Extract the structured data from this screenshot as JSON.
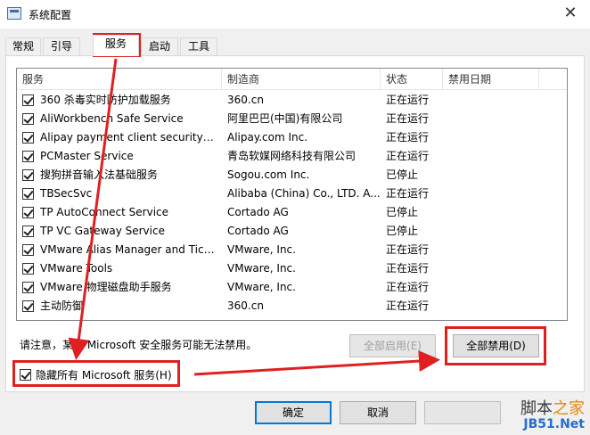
{
  "window": {
    "title": "系统配置",
    "close_glyph": "✕"
  },
  "tabs": [
    "常规",
    "引导",
    "服务",
    "启动",
    "工具"
  ],
  "active_tab": "服务",
  "columns": [
    "服务",
    "制造商",
    "状态",
    "禁用日期"
  ],
  "services": [
    {
      "name": "360 杀毒实时防护加载服务",
      "manufacturer": "360.cn",
      "status": "正在运行",
      "checked": true
    },
    {
      "name": "AliWorkbench Safe Service",
      "manufacturer": "阿里巴巴(中国)有限公司",
      "status": "正在运行",
      "checked": true
    },
    {
      "name": "Alipay payment client security ser...",
      "manufacturer": "Alipay.com Inc.",
      "status": "正在运行",
      "checked": true
    },
    {
      "name": "PCMaster Service",
      "manufacturer": "青岛软媒网络科技有限公司",
      "status": "正在运行",
      "checked": true
    },
    {
      "name": "搜狗拼音输入法基础服务",
      "manufacturer": "Sogou.com Inc.",
      "status": "已停止",
      "checked": true
    },
    {
      "name": "TBSecSvc",
      "manufacturer": "Alibaba (China) Co., LTD. A...",
      "status": "正在运行",
      "checked": true
    },
    {
      "name": "TP AutoConnect Service",
      "manufacturer": "Cortado AG",
      "status": "已停止",
      "checked": true
    },
    {
      "name": "TP VC Gateway Service",
      "manufacturer": "Cortado AG",
      "status": "已停止",
      "checked": true
    },
    {
      "name": "VMware Alias Manager and Tick...",
      "manufacturer": "VMware, Inc.",
      "status": "正在运行",
      "checked": true
    },
    {
      "name": "VMware Tools",
      "manufacturer": "VMware, Inc.",
      "status": "正在运行",
      "checked": true
    },
    {
      "name": "VMware 物理磁盘助手服务",
      "manufacturer": "VMware, Inc.",
      "status": "正在运行",
      "checked": true
    },
    {
      "name": "主动防御",
      "manufacturer": "360.cn",
      "status": "正在运行",
      "checked": true
    }
  ],
  "notice": "请注意，某些 Microsoft 安全服务可能无法禁用。",
  "buttons": {
    "enable_all": "全部启用(E)",
    "disable_all": "全部禁用(D)",
    "ok": "确定",
    "cancel": "取消",
    "apply": ""
  },
  "hide_ms": {
    "label": "隐藏所有 Microsoft 服务(H)",
    "checked": true
  },
  "watermark": {
    "line1_a": "脚本",
    "line1_b": "之家",
    "line2": "JB51.Net"
  },
  "colors": {
    "annotation_red": "#e02020",
    "focus_blue": "#0078d7"
  }
}
